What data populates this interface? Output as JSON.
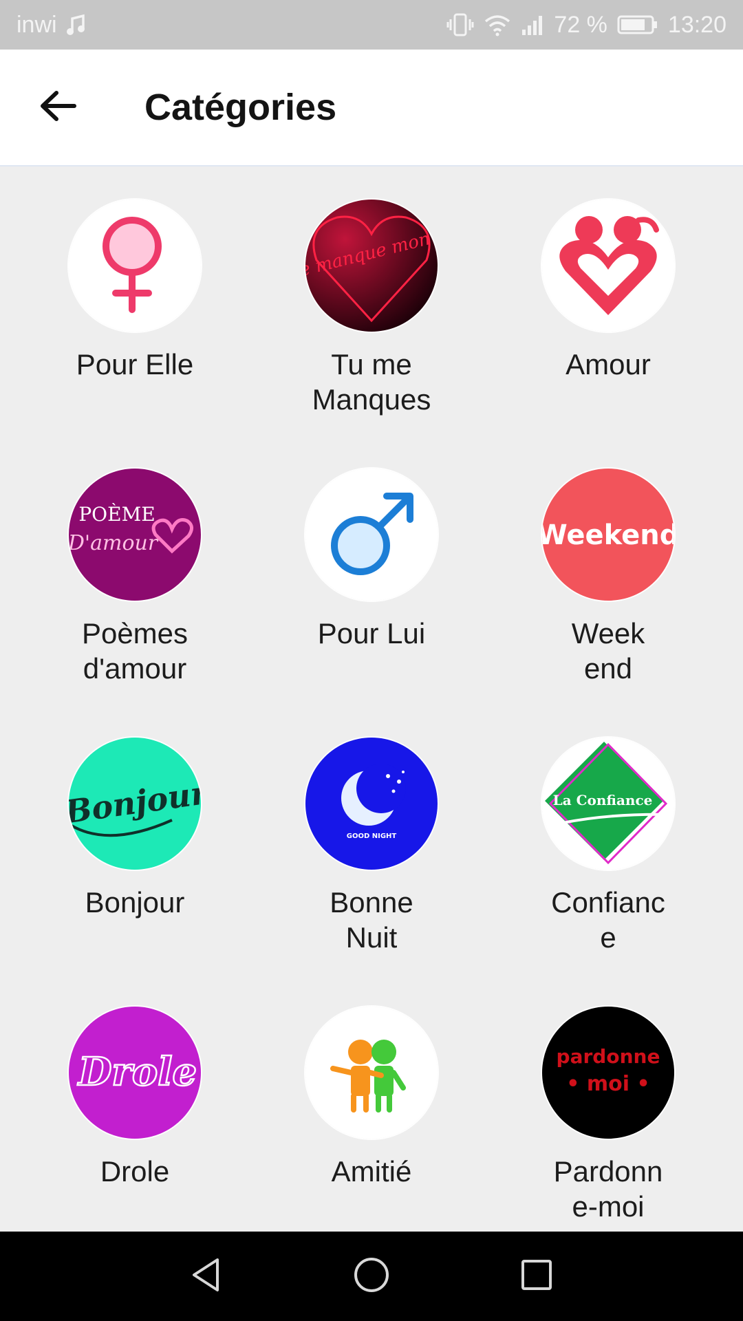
{
  "status_bar": {
    "carrier": "inwi",
    "battery": "72 %",
    "time": "13:20"
  },
  "header": {
    "title": "Catégories",
    "back_icon": "arrow-left-icon"
  },
  "categories": [
    {
      "label": "Pour Elle",
      "icon": "female-symbol-icon"
    },
    {
      "label": "Tu me Manques",
      "icon": "heart-tu-me-manque-icon",
      "image_text": "Tu me manque mon coeur"
    },
    {
      "label": "Amour",
      "icon": "couple-heart-icon"
    },
    {
      "label": "Poèmes d'amour",
      "icon": "poeme-damour-icon",
      "image_text": "POÈME D'amour"
    },
    {
      "label": "Pour Lui",
      "icon": "male-symbol-icon"
    },
    {
      "label": "Week end",
      "icon": "weekend-icon",
      "image_text": "Weekend"
    },
    {
      "label": "Bonjour",
      "icon": "bonjour-icon",
      "image_text": "Bonjour"
    },
    {
      "label": "Bonne Nuit",
      "icon": "moon-good-night-icon",
      "image_text": "GOOD NIGHT"
    },
    {
      "label": "Confiance",
      "icon": "la-confiance-icon",
      "image_text": "La Confiance"
    },
    {
      "label": "Drole",
      "icon": "drole-icon",
      "image_text": "Drole"
    },
    {
      "label": "Amitié",
      "icon": "friends-icon"
    },
    {
      "label": "Pardonne-moi",
      "icon": "pardonne-moi-icon",
      "image_text": "pardonne moi"
    }
  ],
  "nav_bar": {
    "back": "nav-back-icon",
    "home": "nav-home-icon",
    "recents": "nav-recents-icon"
  },
  "colors": {
    "status_bar": "#c6c6c6",
    "background": "#eeeeee",
    "app_bar": "#ffffff",
    "nav_bar": "#000000",
    "pink": "#ee3a57"
  }
}
